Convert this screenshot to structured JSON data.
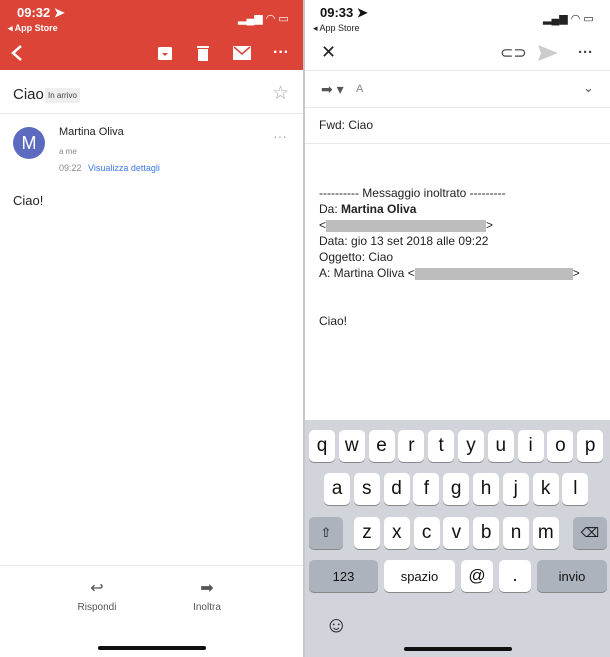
{
  "left": {
    "status": {
      "time": "09:32 ➤",
      "back": "◂ App Store"
    },
    "toolbar": {
      "icons": [
        "back-chevron-icon",
        "archive-icon",
        "trash-icon",
        "mail-icon",
        "more-icon"
      ]
    },
    "subject": "Ciao",
    "label": "In arrivo",
    "sender": {
      "avatar": "M",
      "name": "Martina Oliva",
      "to": "a me",
      "time": "09:22",
      "details": "Visualizza dettagli"
    },
    "body": "Ciao!",
    "actions": {
      "reply": "Rispondi",
      "forward": "Inoltra"
    },
    "colors": {
      "header": "#db4437",
      "avatar": "#5c6bc0",
      "link": "#3b78e7"
    }
  },
  "right": {
    "status": {
      "time": "09:33 ➤",
      "back": "◂ App Store"
    },
    "to_label": "A",
    "subject": "Fwd: Ciao",
    "body": {
      "separator": "---------- Messaggio inoltrato ---------",
      "from_label": "Da: ",
      "from_name": "Martina Oliva",
      "email_open": "<",
      "email_close": ">",
      "date": "Data: gio 13 set 2018 alle 09:22",
      "subject": "Oggetto: Ciao",
      "to": "A: Martina Oliva <",
      "text": "Ciao!"
    },
    "keyboard": {
      "row1": [
        "q",
        "w",
        "e",
        "r",
        "t",
        "y",
        "u",
        "i",
        "o",
        "p"
      ],
      "row2": [
        "a",
        "s",
        "d",
        "f",
        "g",
        "h",
        "j",
        "k",
        "l"
      ],
      "row3": [
        "z",
        "x",
        "c",
        "v",
        "b",
        "n",
        "m"
      ],
      "numbers": "123",
      "space": "spazio",
      "at": "@",
      "dot": ".",
      "enter": "invio"
    }
  }
}
